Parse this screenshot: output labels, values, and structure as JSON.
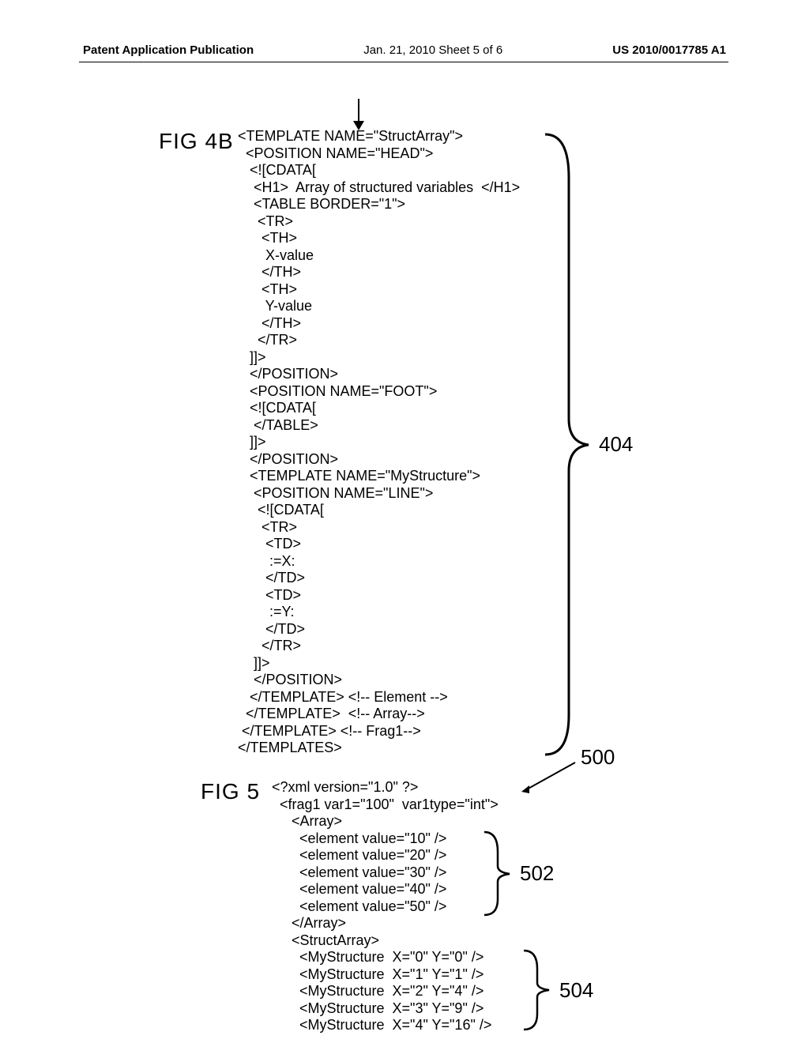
{
  "header": {
    "left": "Patent Application Publication",
    "center": "Jan. 21, 2010  Sheet 5 of 6",
    "right": "US 2010/0017785 A1"
  },
  "fig4b": {
    "label": "FIG  4B",
    "code": "<TEMPLATE NAME=\"StructArray\">\n  <POSITION NAME=\"HEAD\">\n   <![CDATA[\n    <H1>  Array of structured variables  </H1>\n    <TABLE BORDER=\"1\">\n     <TR>\n      <TH>\n       X-value\n      </TH>\n      <TH>\n       Y-value\n      </TH>\n     </TR>\n   ]]>\n   </POSITION>\n   <POSITION NAME=\"FOOT\">\n   <![CDATA[\n    </TABLE>\n   ]]>\n   </POSITION>\n   <TEMPLATE NAME=\"MyStructure\">\n    <POSITION NAME=\"LINE\">\n     <![CDATA[\n      <TR>\n       <TD>\n        :=X:\n       </TD>\n       <TD>\n        :=Y:\n       </TD>\n      </TR>\n    ]]>\n    </POSITION>\n   </TEMPLATE> <!-- Element -->\n  </TEMPLATE>  <!-- Array-->\n </TEMPLATE> <!-- Frag1-->\n</TEMPLATES>",
    "callout": "404"
  },
  "fig5": {
    "label": "FIG  5",
    "code": "<?xml version=\"1.0\" ?>\n  <frag1 var1=\"100\"  var1type=\"int\">\n     <Array>\n       <element value=\"10\" />\n       <element value=\"20\" />\n       <element value=\"30\" />\n       <element value=\"40\" />\n       <element value=\"50\" />\n     </Array>\n     <StructArray>\n       <MyStructure  X=\"0\" Y=\"0\" />\n       <MyStructure  X=\"1\" Y=\"1\" />\n       <MyStructure  X=\"2\" Y=\"4\" />\n       <MyStructure  X=\"3\" Y=\"9\" />\n       <MyStructure  X=\"4\" Y=\"16\" />",
    "callout_top": "500",
    "callout_mid": "502",
    "callout_bot": "504"
  }
}
